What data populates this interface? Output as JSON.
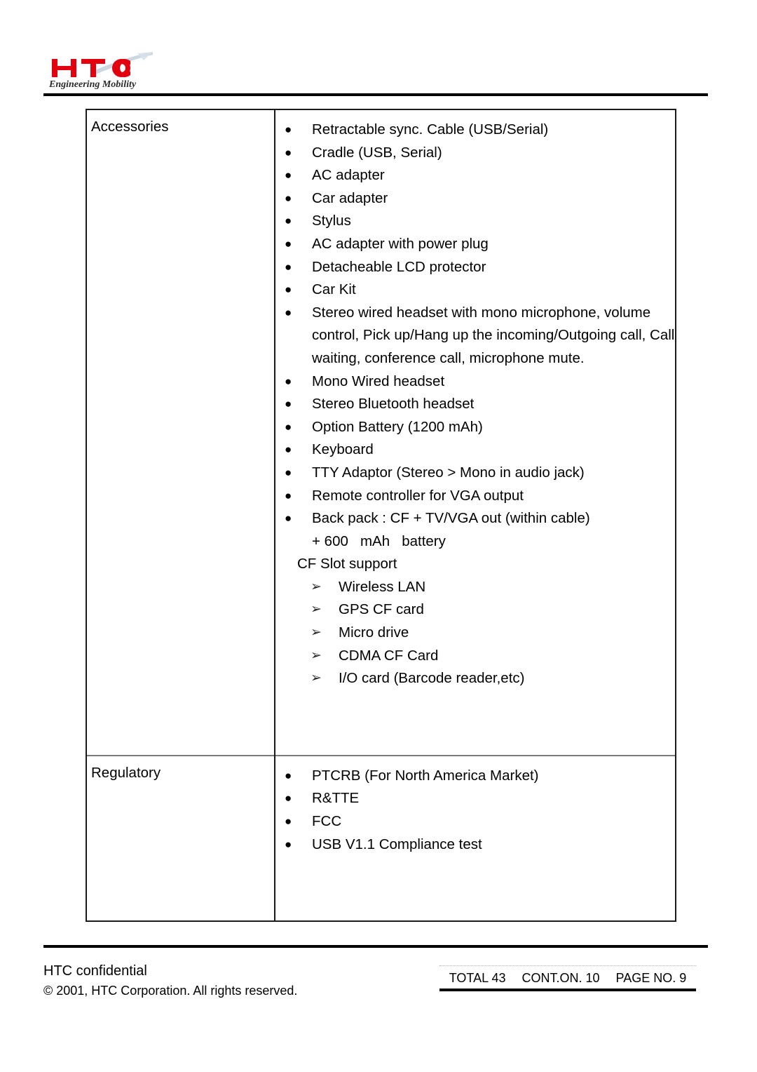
{
  "header": {
    "logo_text": "HTC",
    "logo_tagline": "Engineering Mobility",
    "logo_color": "#e3000f",
    "logo_swoosh_color": "#b9c7d6"
  },
  "table": {
    "rows": [
      {
        "label": "Accessories",
        "items": [
          {
            "marker": "bullet",
            "text": "Retractable sync. Cable (USB/Serial)"
          },
          {
            "marker": "bullet",
            "text": "Cradle (USB, Serial)"
          },
          {
            "marker": "bullet",
            "text": "AC adapter"
          },
          {
            "marker": "bullet",
            "text": "Car adapter"
          },
          {
            "marker": "bullet",
            "text": "Stylus"
          },
          {
            "marker": "bullet",
            "text": "AC adapter with power plug"
          },
          {
            "marker": "bullet",
            "text": "Detacheable LCD protector"
          },
          {
            "marker": "bullet",
            "text": "Car Kit"
          },
          {
            "marker": "bullet",
            "text": "Stereo wired headset with mono microphone, volume control, Pick up/Hang up the incoming/Outgoing call, Call waiting, conference call, microphone mute."
          },
          {
            "marker": "bullet",
            "text": "Mono Wired headset"
          },
          {
            "marker": "bullet",
            "text": "Stereo Bluetooth headset"
          },
          {
            "marker": "bullet",
            "text": "Option Battery (1200 mAh)"
          },
          {
            "marker": "bullet",
            "text": "Keyboard"
          },
          {
            "marker": "bullet",
            "text": "TTY Adaptor (Stereo > Mono in audio jack)"
          },
          {
            "marker": "bullet",
            "text": "Remote controller for VGA output"
          },
          {
            "marker": "bullet",
            "text": "Back pack : CF + TV/VGA out (within cable)"
          },
          {
            "marker": "continuation",
            "text": "+ 600   mAh   battery"
          },
          {
            "marker": "cfslot",
            "text": "CF Slot support"
          },
          {
            "marker": "arrow",
            "text": "Wireless LAN"
          },
          {
            "marker": "arrow",
            "text": "GPS CF card"
          },
          {
            "marker": "arrow",
            "text": "Micro drive"
          },
          {
            "marker": "arrow",
            "text": "CDMA CF Card"
          },
          {
            "marker": "arrow",
            "text": "I/O card (Barcode reader,etc)"
          }
        ]
      },
      {
        "label": "Regulatory",
        "items": [
          {
            "marker": "bullet",
            "text": "PTCRB (For North America Market)"
          },
          {
            "marker": "bullet",
            "text": "R&TTE"
          },
          {
            "marker": "bullet",
            "text": "FCC"
          },
          {
            "marker": "bullet",
            "text": "USB V1.1 Compliance test"
          }
        ]
      }
    ]
  },
  "footer": {
    "confidential": "HTC confidential",
    "copyright": "© 2001, HTC Corporation. All rights reserved.",
    "total": "TOTAL 43",
    "continued_on": "CONT.ON. 10",
    "page_no": "PAGE NO. 9"
  },
  "glyphs": {
    "bullet": "●",
    "arrow": "➢"
  }
}
